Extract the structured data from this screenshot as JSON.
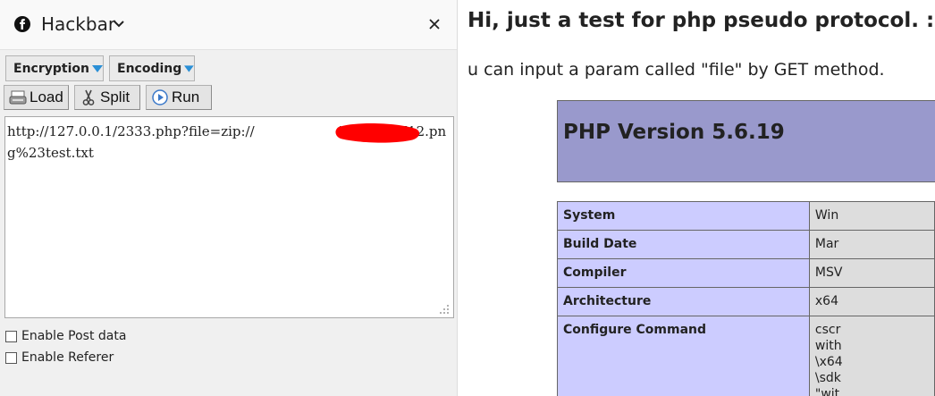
{
  "hackbar": {
    "title": "Hackbar",
    "menus": {
      "encryption": "Encryption",
      "encoding": "Encoding"
    },
    "toolbar": {
      "load": "Load",
      "split": "Split",
      "run": "Run"
    },
    "url": "http://127.0.0.1/2333.php?file=zip://                    \\www\\SKI12.png%23test.txt",
    "options": {
      "post_data": "Enable Post data",
      "referer": "Enable Referer"
    },
    "redaction_color": "#ff0000"
  },
  "page": {
    "heading": "Hi, just a test for php pseudo protocol. :)",
    "intro": "u can input a param called \"file\" by GET method.",
    "phpinfo": {
      "version": "PHP Version 5.6.19",
      "rows": [
        {
          "key": "System",
          "value": "Win"
        },
        {
          "key": "Build Date",
          "value": "Mar"
        },
        {
          "key": "Compiler",
          "value": "MSV"
        },
        {
          "key": "Architecture",
          "value": "x64"
        },
        {
          "key": "Configure Command",
          "value": "cscr\nwith\n\\x64\n\\sdk\n\"wit"
        }
      ]
    }
  }
}
